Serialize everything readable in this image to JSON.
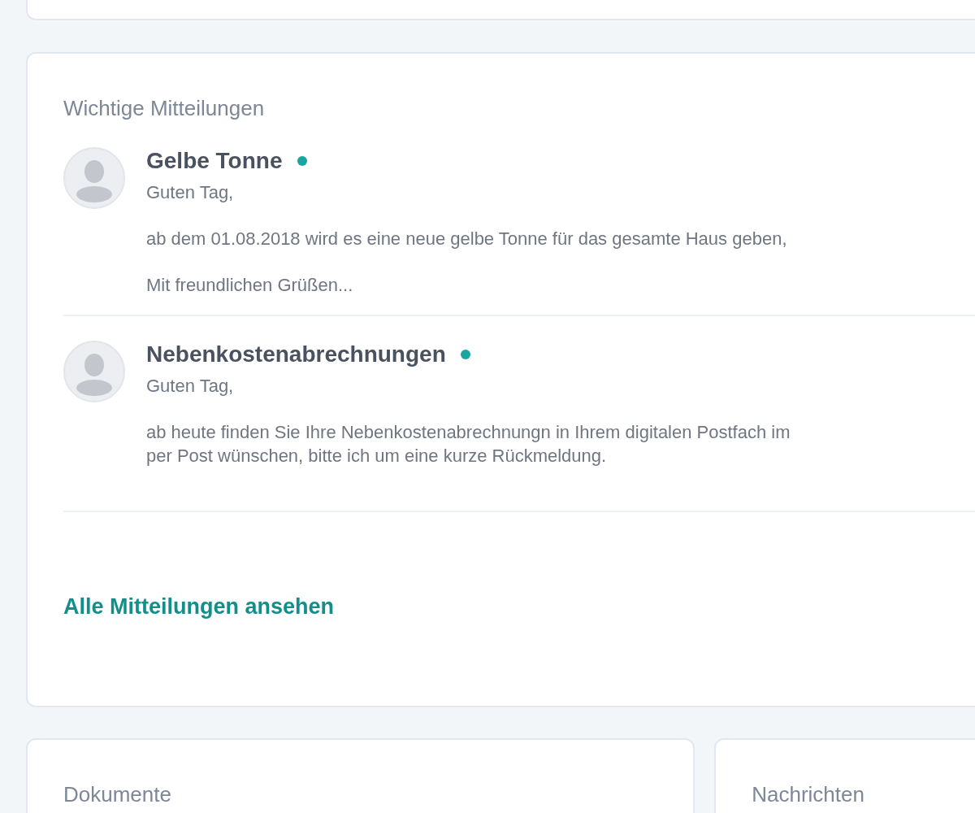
{
  "notices": {
    "title": "Wichtige Mitteilungen",
    "items": [
      {
        "subject": "Gelbe Tonne",
        "unread": true,
        "greeting": "Guten Tag,",
        "body_lines": [
          "ab dem 01.08.2018 wird es eine neue gelbe Tonne für das gesamte Haus geben,"
        ],
        "closing": "Mit freundlichen Grüßen..."
      },
      {
        "subject": "Nebenkostenabrechnungen",
        "unread": true,
        "greeting": "Guten Tag,",
        "body_lines": [
          "ab heute finden Sie Ihre Nebenkostenabrechnungn in Ihrem digitalen Postfach im",
          "per Post wünschen, bitte ich um eine kurze Rückmeldung."
        ]
      }
    ],
    "link": "Alle Mitteilungen ansehen"
  },
  "bottom_cards": [
    {
      "title": "Dokumente"
    },
    {
      "title": "Nachrichten"
    }
  ]
}
